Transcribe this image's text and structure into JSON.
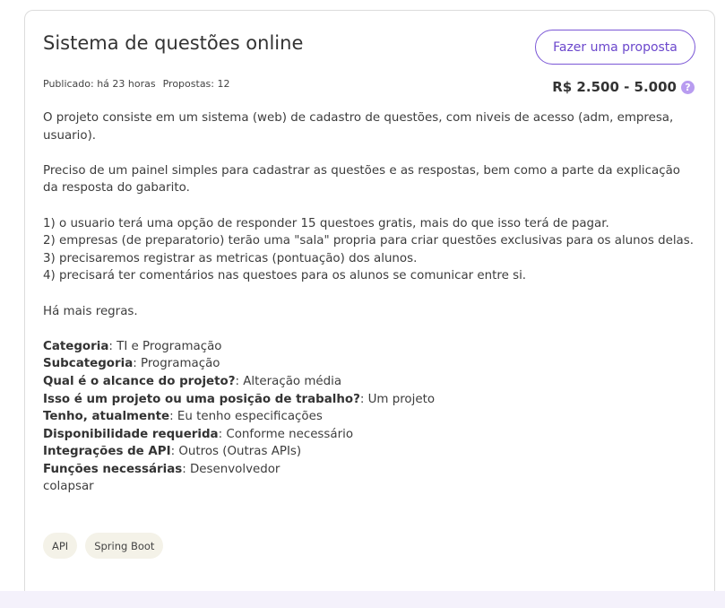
{
  "project": {
    "title": "Sistema de questões online",
    "proposal_button": "Fazer uma proposta",
    "published": "Publicado: há 23 horas",
    "proposals": "Propostas: 12",
    "price": "R$ 2.500 - 5.000",
    "help_glyph": "?",
    "description": [
      "O projeto consiste em um sistema (web) de cadastro de questões, com niveis de acesso (adm, empresa, usuario).",
      "",
      "Preciso de um painel simples para cadastrar as questões e as respostas, bem como a parte da explicação da resposta do gabarito.",
      "",
      "1) o usuario terá uma opção de responder 15 questoes gratis, mais do que isso terá de pagar.",
      "2) empresas (de preparatorio) terão uma \"sala\" propria para criar questões exclusivas para os alunos delas.",
      "3) precisaremos registrar as metricas (pontuação) dos alunos.",
      "4) precisará ter comentários nas questoes para os alunos se comunicar entre si.",
      "",
      "Há mais regras.",
      ""
    ],
    "details": [
      {
        "key": "Categoria",
        "value": ": TI e Programação"
      },
      {
        "key": "Subcategoria",
        "value": ": Programação"
      },
      {
        "key": "Qual é o alcance do projeto?",
        "value": ": Alteração média"
      },
      {
        "key": "Isso é um projeto ou uma posição de trabalho?",
        "value": ": Um projeto"
      },
      {
        "key": "Tenho, atualmente",
        "value": ": Eu tenho especificações"
      },
      {
        "key": "Disponibilidade requerida",
        "value": ": Conforme necessário"
      },
      {
        "key": "Integrações de API",
        "value": ": Outros (Outras APIs)"
      },
      {
        "key": "Funções necessárias",
        "value": ": Desenvolvedor"
      }
    ],
    "collapse_link": "colapsar",
    "tags": [
      "API",
      "Spring Boot"
    ]
  },
  "colors": {
    "accent": "#7b57d6",
    "help_icon": "#b89cf0",
    "tag_bg": "#f4f2e8",
    "bottom_band": "#f4f1fb"
  },
  "icons": {
    "help": "question-circle-icon"
  }
}
